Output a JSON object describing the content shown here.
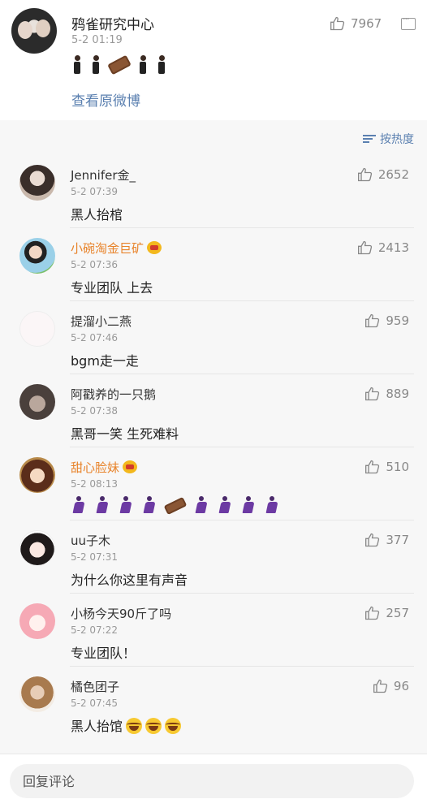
{
  "post": {
    "author": "鸦雀研究中心",
    "time": "5-2 01:19",
    "likes": "7967",
    "view_original": "查看原微博"
  },
  "sort_label": "按热度",
  "comments": [
    {
      "name": "Jennifer金_",
      "time": "5-2 07:39",
      "text": "黑人抬棺",
      "likes": "2652",
      "vip": false
    },
    {
      "name": "小碗淘金巨矿",
      "time": "5-2 07:36",
      "text": "专业团队 上去",
      "likes": "2413",
      "vip": true
    },
    {
      "name": "提溜小二燕",
      "time": "5-2 07:46",
      "text": "bgm走一走",
      "likes": "959",
      "vip": false
    },
    {
      "name": "阿戳养的一只鹅",
      "time": "5-2 07:38",
      "text": "黑哥一笑 生死难料",
      "likes": "889",
      "vip": false
    },
    {
      "name": "甜心脸妹",
      "time": "5-2 08:13",
      "text": "",
      "likes": "510",
      "vip": true,
      "emoji": "dancers-coffin"
    },
    {
      "name": "uu子木",
      "time": "5-2 07:31",
      "text": "为什么你这里有声音",
      "likes": "377",
      "vip": false
    },
    {
      "name": "小杨今天90斤了吗",
      "time": "5-2 07:22",
      "text": "专业团队！",
      "likes": "257",
      "vip": false
    },
    {
      "name": "橘色团子",
      "time": "5-2 07:45",
      "text": "黑人抬馆",
      "likes": "96",
      "vip": false,
      "emoji": "laugh-x3"
    }
  ],
  "reply": {
    "placeholder": "回复评论"
  },
  "icons": {
    "like": "thumbs-up-icon",
    "more": "comment-box-icon",
    "sort": "sort-icon"
  },
  "colors": {
    "link": "#5b80b0",
    "vip_name": "#e8832a",
    "background": "#f7f7f7"
  }
}
